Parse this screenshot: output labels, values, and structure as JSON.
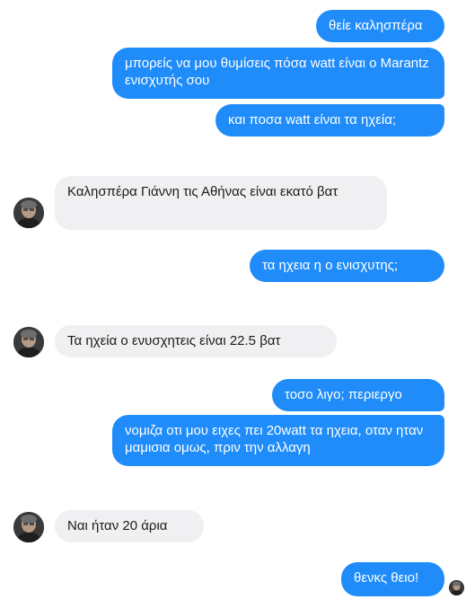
{
  "conversation": {
    "messages": [
      {
        "sender": "me",
        "text": "θείε καλησπέρα"
      },
      {
        "sender": "me",
        "text": "μπορείς να μου θυμίσεις πόσα watt είναι ο Marantz ενισχυτής σου"
      },
      {
        "sender": "me",
        "text": "και ποσα watt είναι τα ηχεία;"
      },
      {
        "sender": "contact",
        "text": "Καλησπέρα Γιάννη τις Αθήνας είναι εκατό βατ"
      },
      {
        "sender": "me",
        "text": "τα ηχεια η ο ενισχυτης;"
      },
      {
        "sender": "contact",
        "text": "Τα ηχεία ο ενυσχητεις είναι 22.5 βατ"
      },
      {
        "sender": "me",
        "text": "τοσο λιγο; περιεργο"
      },
      {
        "sender": "me",
        "text": "νομιζα οτι μου ειχες πει 20watt τα ηχεια, οταν ηταν μαμισια ομως, πριν την αλλαγη"
      },
      {
        "sender": "contact",
        "text": "Ναι ήταν 20 άρια"
      },
      {
        "sender": "me",
        "text": "θενκς θειο!"
      }
    ]
  },
  "colors": {
    "outgoing_bubble": "#1f8cf9",
    "incoming_bubble": "#f0eff1",
    "outgoing_text": "#ffffff",
    "incoming_text": "#1c1c1c"
  },
  "icons": {
    "contact_avatar": "contact-avatar-photo",
    "read_receipt": "read-receipt-avatar"
  }
}
